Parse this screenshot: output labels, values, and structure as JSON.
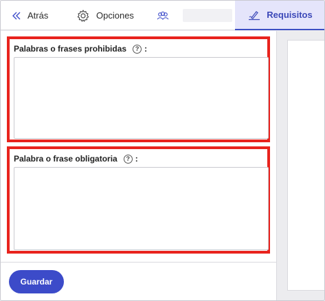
{
  "nav": {
    "back_label": "Atrás",
    "options_label": "Opciones",
    "users_label": "",
    "requirements_label": "Requisitos",
    "active_color": "#3b48b8"
  },
  "form": {
    "forbidden": {
      "label": "Palabras o frases prohibidas",
      "help": "?",
      "colon": ":",
      "value": ""
    },
    "required": {
      "label": "Palabra o frase obligatoria",
      "help": "?",
      "colon": ":",
      "value": ""
    },
    "highlight_color": "#e8231d"
  },
  "footer": {
    "save_label": "Guardar",
    "save_color": "#3c4bc9"
  }
}
